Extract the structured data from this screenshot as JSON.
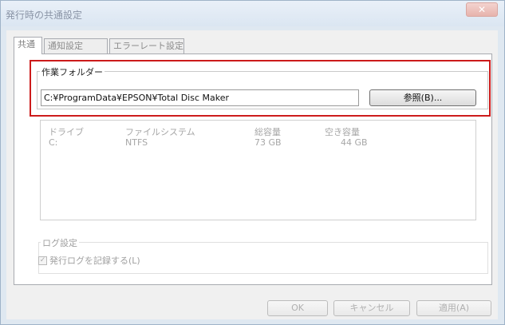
{
  "window": {
    "title": "発行時の共通設定",
    "close_label": "✕"
  },
  "tabs": [
    {
      "label": "共通"
    },
    {
      "label": "通知設定"
    },
    {
      "label": "エラーレート設定"
    }
  ],
  "work_folder": {
    "legend": "作業フォルダー",
    "path": "C:¥ProgramData¥EPSON¥Total Disc Maker",
    "browse_label": "参照(B)..."
  },
  "drives": {
    "headers": [
      "ドライブ",
      "ファイルシステム",
      "総容量",
      "空き容量"
    ],
    "rows": [
      [
        "C:",
        "NTFS",
        "73 GB",
        "44 GB"
      ]
    ]
  },
  "log": {
    "legend": "ログ設定",
    "checkbox_label": "発行ログを記録する(L)",
    "checked": true
  },
  "buttons": {
    "ok": "OK",
    "cancel": "キャンセル",
    "apply": "適用(A)"
  }
}
